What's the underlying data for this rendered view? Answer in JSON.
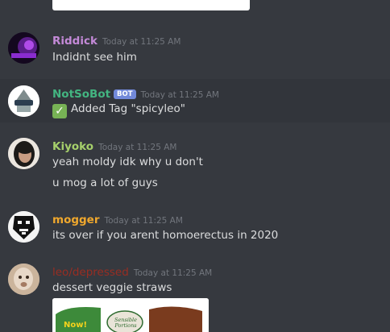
{
  "messages": [
    {
      "username": "Riddick",
      "color": "#c48ad8",
      "timestamp": "Today at 11:25 AM",
      "lines": [
        "Indidnt see him"
      ]
    },
    {
      "username": "NotSoBot",
      "color": "#43b581",
      "bot_label": "BOT",
      "timestamp": "Today at 11:25 AM",
      "lines": [
        "Added Tag \"spicyleo\""
      ]
    },
    {
      "username": "Kiyoko",
      "color": "#a6d06b",
      "timestamp": "Today at 11:25 AM",
      "lines": [
        "yeah moldy idk why u don't",
        "u mog a lot of guys"
      ]
    },
    {
      "username": "mogger",
      "color": "#f0a82d",
      "timestamp": "Today at 11:25 AM",
      "lines": [
        "its over if you arent homoerectus in 2020"
      ]
    },
    {
      "username": "leo/depressed",
      "color": "#992d22",
      "timestamp": "Today at 11:25 AM",
      "lines": [
        "dessert veggie straws"
      ]
    }
  ],
  "attachment": {
    "label_a": "Now!",
    "label_b": "Sensible Portions"
  }
}
